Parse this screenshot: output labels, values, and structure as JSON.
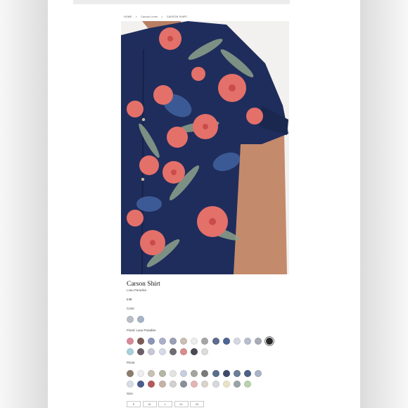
{
  "breadcrumb": {
    "items": [
      "HOME",
      "Carson Linen",
      "CARSON SHIRT"
    ],
    "separator": ">"
  },
  "product": {
    "title": "Carson Shirt",
    "subtitle": "Luau Paradise",
    "price": "£48"
  },
  "color_label": "Color:",
  "floral_label": "Floral:  Luau Paradise",
  "prints_label": "Prints:",
  "size_label": "Size:",
  "sizes": [
    "S",
    "M",
    "L",
    "XL",
    "2X"
  ],
  "swatches": {
    "color": [
      "#b9bec7",
      "#a6b3c7"
    ],
    "floral_row1": [
      "#d98a98",
      "#7b5c55",
      "#8b95b8",
      "#aab0cc",
      "#9aa0b5",
      "#cbbfb3",
      "#ececec",
      "#a5a5a5",
      "#5d6b8c",
      "#4e6593",
      "#d5d8e0",
      "#b8bdd0",
      "#a7acb5",
      "#2a2a2a"
    ],
    "floral_row2": [
      "#a8d0dc",
      "#6d5f6a",
      "#c6c8d6",
      "#d6d9e6",
      "#6c6c72",
      "#d98c8c",
      "#4a4a55",
      "#dcdcdc"
    ],
    "prints_row1": [
      "#8c7c6c",
      "#eeeeee",
      "#c8c2b5",
      "#b7b7a5",
      "#e4e4e4",
      "#c8cfe0",
      "#a5a5a0",
      "#7a7a7a",
      "#5a6f8c",
      "#3f4b6c",
      "#6b7f96",
      "#4d6184",
      "#a9b4c6"
    ],
    "prints_row2": [
      "#d7dce6",
      "#4b5d8c",
      "#b55a5a",
      "#c4b4a6",
      "#d2d2d2",
      "#8a8f9a",
      "#e3b5b5",
      "#d9d3cc",
      "#d5d8dc",
      "#e9e4c8",
      "#9aa3a8",
      "#b9d3b0"
    ],
    "selected": "#2a2a2a"
  },
  "colors": {
    "shirt": "#1f2d5c",
    "hibiscus": "#e4706a",
    "leaf": "#8c9f8a",
    "skin": "#c48a6c"
  }
}
